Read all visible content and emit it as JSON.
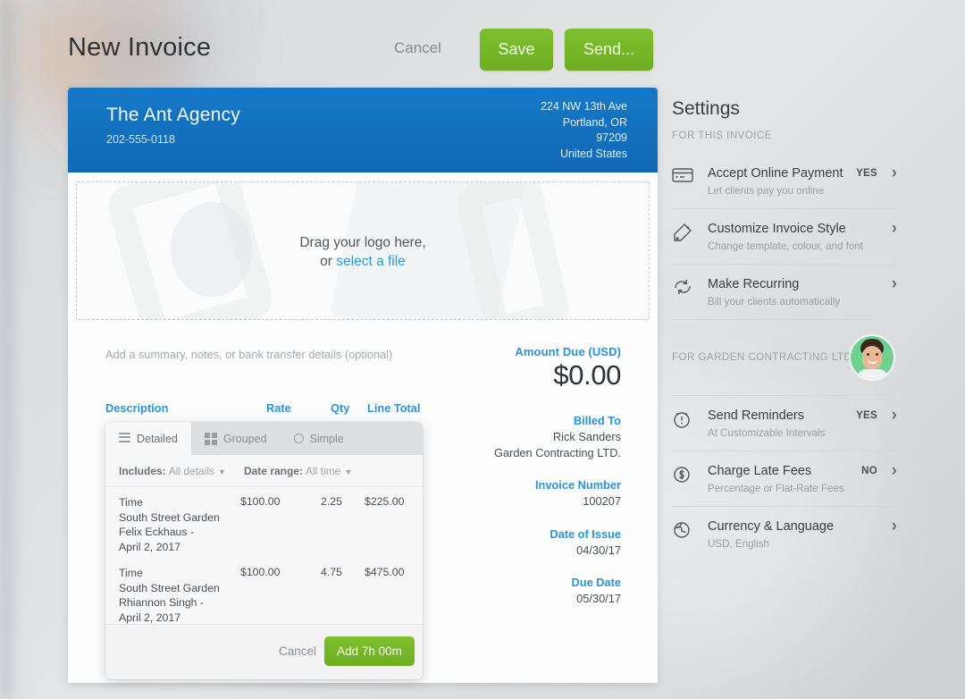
{
  "header": {
    "title": "New Invoice",
    "cancel_label": "Cancel",
    "save_label": "Save",
    "send_label": "Send...",
    "accent_green": "#76b82a"
  },
  "invoice": {
    "accent_blue": "#1479c8",
    "company_name": "The Ant Agency",
    "company_phone": "202-555-0118",
    "address_line1": "224 NW 13th Ave",
    "address_line2": "Portland, OR",
    "address_line3": "97209",
    "address_line4": "United States",
    "dropzone_text": "Drag your logo here,",
    "dropzone_or": "or ",
    "dropzone_link": "select a file",
    "notes_placeholder": "Add a summary, notes, or bank transfer details (optional)",
    "amount_label": "Amount Due (USD)",
    "amount_value": "$0.00",
    "meta": [
      {
        "label": "Billed To",
        "value": "Rick Sanders\nGarden Contracting LTD."
      },
      {
        "label": "Invoice Number",
        "value": "100207"
      },
      {
        "label": "Date of Issue",
        "value": "04/30/17"
      },
      {
        "label": "Due Date",
        "value": "05/30/17"
      }
    ],
    "columns": {
      "description": "Description",
      "rate": "Rate",
      "qty": "Qty",
      "line_total": "Line Total"
    }
  },
  "popup": {
    "tabs": [
      {
        "label": "Detailed",
        "icon": "list-icon",
        "active": true
      },
      {
        "label": "Grouped",
        "icon": "grid-icon",
        "active": false
      },
      {
        "label": "Simple",
        "icon": "circle-icon",
        "active": false
      }
    ],
    "filters": {
      "includes_label": "Includes:",
      "includes_value": "All details",
      "date_range_label": "Date range:",
      "date_range_value": "All time"
    },
    "rows": [
      {
        "description": "Time\nSouth Street Garden\nFelix Eckhaus -\nApril 2, 2017",
        "rate": "$100.00",
        "qty": "2.25",
        "total": "$225.00"
      },
      {
        "description": "Time\nSouth Street Garden\nRhiannon Singh -\nApril 2, 2017",
        "rate": "$100.00",
        "qty": "4.75",
        "total": "$475.00"
      }
    ],
    "cancel_label": "Cancel",
    "add_label": "Add 7h 00m"
  },
  "settings": {
    "title": "Settings",
    "subtitle": "FOR THIS INVOICE",
    "items_top": [
      {
        "name": "Accept Online Payment",
        "desc": "Let clients pay you online",
        "state": "YES",
        "icon": "credit-card-icon"
      },
      {
        "name": "Customize Invoice Style",
        "desc": "Change template, colour, and font",
        "state": "",
        "icon": "paint-roller-icon"
      },
      {
        "name": "Make Recurring",
        "desc": "Bill your clients automatically",
        "state": "",
        "icon": "refresh-icon"
      }
    ],
    "client_label": "FOR GARDEN CONTRACTING LTD.",
    "avatar_bg": "#6fd18f",
    "items_bottom": [
      {
        "name": "Send Reminders",
        "desc": "At Customizable Intervals",
        "state": "YES",
        "icon": "alarm-clock-icon"
      },
      {
        "name": "Charge Late Fees",
        "desc": "Percentage or Flat-Rate Fees",
        "state": "NO",
        "icon": "dollar-circle-icon"
      },
      {
        "name": "Currency & Language",
        "desc": "USD, English",
        "state": "",
        "icon": "globe-icon"
      }
    ]
  }
}
